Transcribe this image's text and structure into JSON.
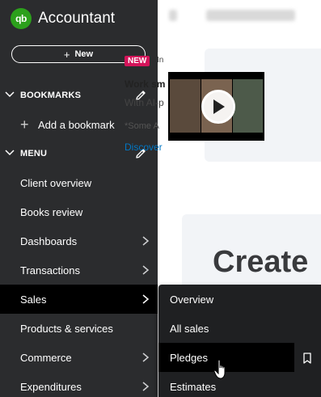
{
  "brand": {
    "logo_text": "qb",
    "name": "Accountant",
    "color": "#2ca01c"
  },
  "new_button": {
    "label": "New"
  },
  "bookmarks": {
    "title": "BOOKMARKS",
    "add_label": "Add a bookmark"
  },
  "menu": {
    "title": "MENU",
    "items": [
      {
        "label": "Client overview",
        "has_arrow": false
      },
      {
        "label": "Books review",
        "has_arrow": false
      },
      {
        "label": "Dashboards",
        "has_arrow": true
      },
      {
        "label": "Transactions",
        "has_arrow": true
      },
      {
        "label": "Sales",
        "has_arrow": true,
        "active": true
      },
      {
        "label": "Products & services",
        "has_arrow": false
      },
      {
        "label": "Commerce",
        "has_arrow": true
      },
      {
        "label": "Expenditures",
        "has_arrow": true
      }
    ]
  },
  "flyout": {
    "items": [
      {
        "label": "Overview"
      },
      {
        "label": "All sales"
      },
      {
        "label": "Pledges",
        "hovered": true
      },
      {
        "label": "Estimates"
      }
    ]
  },
  "promo": {
    "badge": "NEW",
    "badge_tail": "In",
    "title": "Work sm",
    "subtitle": "With AI-p",
    "note": "*Some A",
    "link": "Discover"
  },
  "main": {
    "heading": "Create"
  },
  "colors": {
    "sidebar": "#2b2c2e",
    "flyout": "#1f2022",
    "active": "#000000",
    "badge": "#d4145a",
    "link": "#0077c5"
  }
}
